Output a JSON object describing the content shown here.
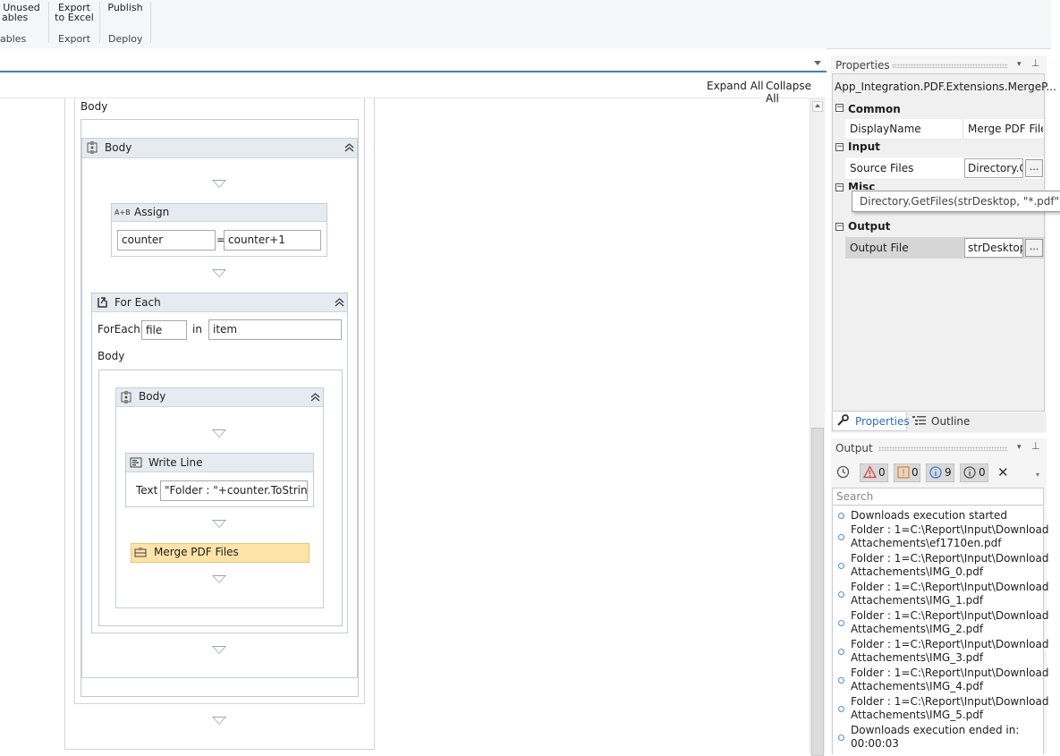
{
  "ribbon": {
    "unused_line1": "Unused",
    "unused_line2": "ables",
    "variables_group": "ables",
    "export_line1": "Export",
    "export_line2": "to Excel",
    "export_group": "Export",
    "publish": "Publish",
    "deploy_group": "Deploy"
  },
  "designer": {
    "expand_all": "Expand All",
    "collapse_all": "Collapse All",
    "outer_body_label": "Body",
    "body_seq": {
      "title": "Body"
    },
    "assign": {
      "title": "Assign",
      "icon_text": "A+B",
      "to": "counter",
      "equals": "=",
      "value": "counter+1"
    },
    "foreach": {
      "title": "For Each",
      "foreach_label": "ForEach",
      "var": "file",
      "in_label": "in",
      "values": "item",
      "body_label": "Body"
    },
    "inner_body": {
      "title": "Body"
    },
    "writeline": {
      "title": "Write Line",
      "text_label": "Text",
      "text_value": "\"Folder : \"+counter.ToString+"
    },
    "merge": {
      "title": "Merge PDF Files"
    }
  },
  "properties": {
    "title": "Properties",
    "object_name": "App_Integration.PDF.Extensions.MergeP...",
    "categories": {
      "common": "Common",
      "input": "Input",
      "misc": "Misc",
      "output": "Output"
    },
    "rows": {
      "display_name_label": "DisplayName",
      "display_name_value": "Merge PDF Files",
      "source_files_label": "Source Files",
      "source_files_value": "Directory.GetFiles",
      "output_file_label": "Output File",
      "output_file_value": "strDesktop"
    },
    "tooltip": "Directory.GetFiles(strDesktop, \"*.pdf\")",
    "dots": "...",
    "tabs": {
      "properties": "Properties",
      "outline": "Outline"
    }
  },
  "output": {
    "title": "Output",
    "errors": "0",
    "warnings": "0",
    "info": "9",
    "trace": "0",
    "search_placeholder": "Search",
    "lines": [
      [
        "Downloads execution started"
      ],
      [
        "Folder : 1=C:\\Report\\Input\\Download",
        "Attachements\\ef1710en.pdf"
      ],
      [
        "Folder : 1=C:\\Report\\Input\\Download",
        "Attachements\\IMG_0.pdf"
      ],
      [
        "Folder : 1=C:\\Report\\Input\\Download",
        "Attachements\\IMG_1.pdf"
      ],
      [
        "Folder : 1=C:\\Report\\Input\\Download",
        "Attachements\\IMG_2.pdf"
      ],
      [
        "Folder : 1=C:\\Report\\Input\\Download",
        "Attachements\\IMG_3.pdf"
      ],
      [
        "Folder : 1=C:\\Report\\Input\\Download",
        "Attachements\\IMG_4.pdf"
      ],
      [
        "Folder : 1=C:\\Report\\Input\\Download",
        "Attachements\\IMG_5.pdf"
      ],
      [
        "Downloads execution ended in:",
        "00:00:03"
      ]
    ]
  },
  "colors": {
    "accent": "#3d7fc5",
    "merge_highlight": "#fde3a7",
    "selected_row": "#d6d6d6"
  }
}
